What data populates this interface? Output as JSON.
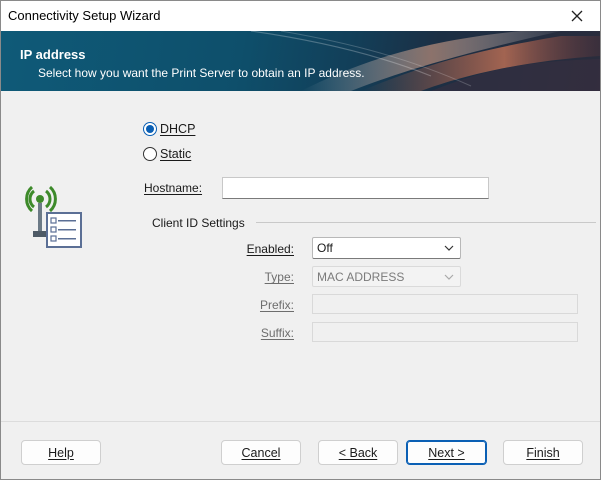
{
  "window": {
    "title": "Connectivity Setup Wizard"
  },
  "banner": {
    "heading": "IP address",
    "subtitle": "Select how you want the Print Server to obtain an IP address."
  },
  "ip_mode": {
    "options": [
      {
        "label": "DHCP",
        "selected": true
      },
      {
        "label": "Static",
        "selected": false
      }
    ]
  },
  "hostname": {
    "label": "Hostname:",
    "value": ""
  },
  "client_id": {
    "group_label": "Client ID Settings",
    "enabled": {
      "label": "Enabled:",
      "value": "Off"
    },
    "type": {
      "label": "Type:",
      "value": "MAC ADDRESS"
    },
    "prefix": {
      "label": "Prefix:",
      "value": ""
    },
    "suffix": {
      "label": "Suffix:",
      "value": ""
    }
  },
  "buttons": {
    "help": "Help",
    "cancel": "Cancel",
    "back": "< Back",
    "next": "Next >",
    "finish": "Finish"
  },
  "colors": {
    "accent": "#0a5fb4",
    "banner": "#0f5a78",
    "icon_green": "#3d8a2a"
  },
  "icons": {
    "close": "close-icon",
    "chevron": "chevron-down-icon",
    "wizard_art": "wireless-network-settings-icon"
  }
}
